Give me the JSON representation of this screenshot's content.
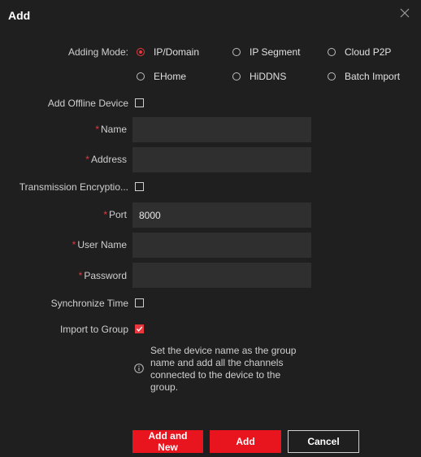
{
  "dialog": {
    "title": "Add"
  },
  "adding_mode": {
    "label": "Adding Mode:",
    "options": [
      {
        "label": "IP/Domain",
        "selected": true
      },
      {
        "label": "IP Segment",
        "selected": false
      },
      {
        "label": "Cloud P2P",
        "selected": false
      },
      {
        "label": "EHome",
        "selected": false
      },
      {
        "label": "HiDDNS",
        "selected": false
      },
      {
        "label": "Batch Import",
        "selected": false
      }
    ]
  },
  "fields": {
    "add_offline": {
      "label": "Add Offline Device",
      "checked": false
    },
    "name": {
      "label": "Name",
      "value": ""
    },
    "address": {
      "label": "Address",
      "value": ""
    },
    "transmission": {
      "label": "Transmission Encryptio...",
      "checked": false
    },
    "port": {
      "label": "Port",
      "value": "8000"
    },
    "username": {
      "label": "User Name",
      "value": ""
    },
    "password": {
      "label": "Password",
      "value": ""
    },
    "sync_time": {
      "label": "Synchronize Time",
      "checked": false
    },
    "import_group": {
      "label": "Import to Group",
      "checked": true
    },
    "required_mark": "*"
  },
  "info": {
    "text": "Set the device name as the group name and add all the channels connected to the device to the group."
  },
  "buttons": {
    "add_and_new": "Add and New",
    "add": "Add",
    "cancel": "Cancel"
  },
  "colors": {
    "accent": "#e8141e",
    "background": "#1f1f1f",
    "input_bg": "#2f2f2f"
  },
  "icons": {
    "close": "close-icon",
    "info": "info-icon"
  }
}
